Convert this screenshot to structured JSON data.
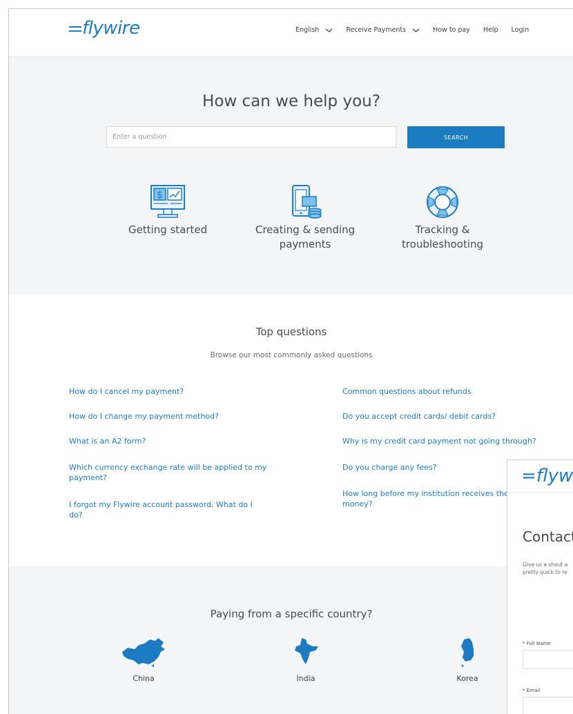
{
  "header": {
    "logo_text": "flywire",
    "nav": [
      {
        "label": "English",
        "dropdown": true
      },
      {
        "label": "Receive Payments",
        "dropdown": true
      },
      {
        "label": "How to pay",
        "dropdown": false
      },
      {
        "label": "Help",
        "dropdown": false
      },
      {
        "label": "Login",
        "dropdown": false
      }
    ]
  },
  "hero": {
    "title": "How can we help you?",
    "search_placeholder": "Enter a question",
    "search_button": "SEARCH",
    "categories": [
      {
        "label": "Getting started",
        "icon": "monitor-dollar-icon"
      },
      {
        "label": "Creating & sending payments",
        "icon": "phone-coins-icon"
      },
      {
        "label": "Tracking & troubleshooting",
        "icon": "lifebuoy-icon"
      }
    ]
  },
  "top_questions": {
    "title": "Top questions",
    "subtitle": "Browse our most commonly asked questions",
    "left": [
      "How do I cancel my payment?",
      "How do I change my payment method?",
      "What is an A2 form?",
      "Which currency exchange rate will be applied to my payment?",
      "I forgot my Flywire account password. What do I do?"
    ],
    "right": [
      "Common questions about refunds",
      "Do you accept credit cards/ debit cards?",
      "Why is my credit card payment not going through?",
      "Do you charge any fees?",
      "How long before my institution receives the money?"
    ]
  },
  "countries": {
    "title": "Paying from a specific country?",
    "items": [
      "China",
      "India",
      "Korea"
    ]
  },
  "contact_panel": {
    "logo_text": "flywire",
    "title": "Contact",
    "subtitle_lines": [
      "Give us a shout a",
      "pretty quick to re"
    ],
    "full_name_label": "* Full Name",
    "email_label": "* Email"
  },
  "colors": {
    "brand_blue": "#1d7bc4",
    "button_blue": "#1c7cc1",
    "hero_bg": "#f4f5f7"
  }
}
